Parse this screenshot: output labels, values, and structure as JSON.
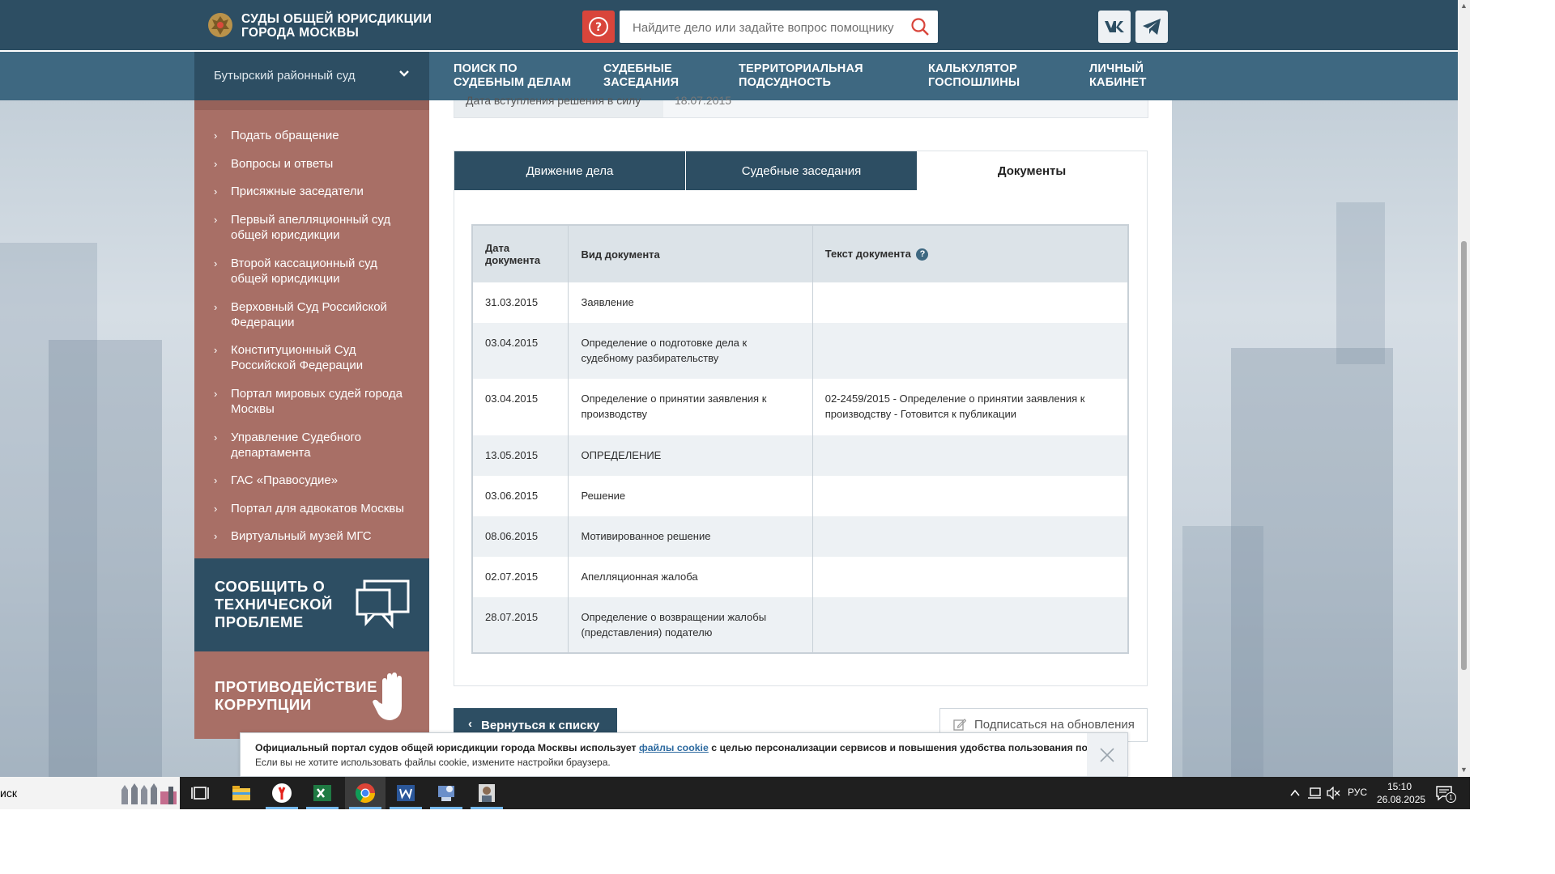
{
  "header": {
    "site_title_line1": "СУДЫ ОБЩЕЙ ЮРИСДИКЦИИ",
    "site_title_line2": "ГОРОДА МОСКВЫ",
    "search_placeholder": "Найдите дело или задайте вопрос помощнику",
    "help_icon": "question-circle-icon",
    "social": [
      "vk-icon",
      "telegram-icon"
    ]
  },
  "nav": {
    "court_select": "Бутырский районный суд",
    "items": [
      "Поиск по\nсудебным делам",
      "Судебные\nзаседания",
      "Территориальная\nподсудность",
      "Калькулятор\nгоспошлины",
      "Личный\nкабинет"
    ]
  },
  "sidebar": {
    "links": [
      "Подать обращение",
      "Вопросы и ответы",
      "Присяжные заседатели",
      "Первый апелляционный суд общей юрисдикции",
      "Второй кассационный суд общей юрисдикции",
      "Верховный Суд Российской Федерации",
      "Конституционный Суд Российской Федерации",
      "Портал мировых судей города Москвы",
      "Управление Судебного департамента",
      "ГАС «Правосудие»",
      "Портал для адвокатов Москвы",
      "Виртуальный музей МГС"
    ],
    "tech_problem_line1": "Сообщить о",
    "tech_problem_line2": "технической",
    "tech_problem_line3": "проблеме",
    "corruption_line1": "Противодействие",
    "corruption_line2": "коррупции"
  },
  "main": {
    "prev_row_label": "Дата вступления решения в силу",
    "prev_row_value": "18.07.2015",
    "tabs": [
      "Движение дела",
      "Судебные заседания",
      "Документы"
    ],
    "active_tab": "Документы",
    "table": {
      "headers": [
        "Дата документа",
        "Вид документа",
        "Текст документа"
      ],
      "rows": [
        {
          "date": "31.03.2015",
          "type": "Заявление",
          "text": ""
        },
        {
          "date": "03.04.2015",
          "type": "Определение о подготовке дела к судебному разбирательству",
          "text": ""
        },
        {
          "date": "03.04.2015",
          "type": "Определение о принятии заявления к производству",
          "text": "02-2459/2015 - Определение о принятии заявления к производству - Готовится к публикации"
        },
        {
          "date": "13.05.2015",
          "type": "ОПРЕДЕЛЕНИЕ",
          "text": ""
        },
        {
          "date": "03.06.2015",
          "type": "Решение",
          "text": ""
        },
        {
          "date": "08.06.2015",
          "type": "Мотивированное решение",
          "text": ""
        },
        {
          "date": "02.07.2015",
          "type": "Апелляционная жалоба",
          "text": ""
        },
        {
          "date": "28.07.2015",
          "type": "Определение о возвращении жалобы (представления) подателю",
          "text": ""
        }
      ]
    },
    "back_button": "Вернуться к списку",
    "subscribe_button": "Подписаться на обновления"
  },
  "cookie": {
    "line1_before": "Официальный портал судов общей юрисдикции города Москвы использует ",
    "line1_link": "файлы cookie",
    "line1_after": " с целью персонализации сервисов и повышения удобства пользования порталом.",
    "line2": "Если вы не хотите использовать файлы cookie, измените настройки браузера."
  },
  "taskbar": {
    "search_text": "иск",
    "apps": [
      "task-view-icon",
      "file-explorer-icon",
      "yandex-browser-icon",
      "excel-icon",
      "chrome-icon",
      "word-icon",
      "app-icon",
      "photo-app-icon"
    ],
    "language": "РУС",
    "time": "15:10",
    "date": "26.08.2025",
    "notification_count": "1"
  },
  "colors": {
    "header_bg": "#2d4e63",
    "nav_bg": "#3e6881",
    "sidebar_bg": "#a86f66",
    "help_red": "#d9453b"
  }
}
